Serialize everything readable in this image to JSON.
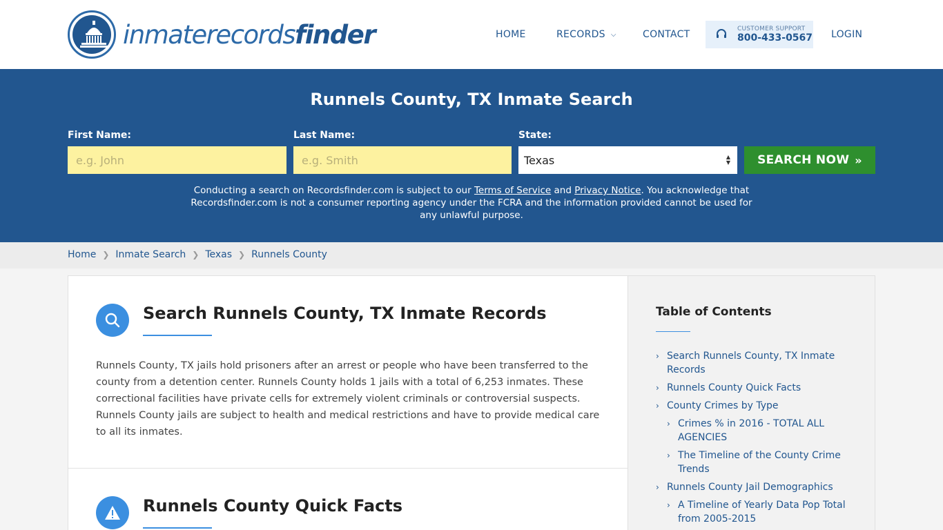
{
  "header": {
    "logo_text_light": "inmaterecords",
    "logo_text_bold": "finder",
    "nav": {
      "home": "HOME",
      "records": "RECORDS",
      "contact": "CONTACT",
      "login": "LOGIN"
    },
    "support": {
      "label": "CUSTOMER SUPPORT",
      "phone": "800-433-0567"
    }
  },
  "hero": {
    "title": "Runnels County, TX Inmate Search",
    "first_name": {
      "label": "First Name:",
      "placeholder": "e.g. John"
    },
    "last_name": {
      "label": "Last Name:",
      "placeholder": "e.g. Smith"
    },
    "state": {
      "label": "State:",
      "value": "Texas"
    },
    "search_button": "SEARCH NOW",
    "disclaimer": {
      "part1": "Conducting a search on Recordsfinder.com is subject to our ",
      "terms": "Terms of Service",
      "and": " and ",
      "privacy": "Privacy Notice",
      "part2": ". You acknowledge that Recordsfinder.com is not a consumer reporting agency under the FCRA and the information provided cannot be used for any unlawful purpose."
    }
  },
  "breadcrumb": [
    "Home",
    "Inmate Search",
    "Texas",
    "Runnels County"
  ],
  "main": {
    "section1": {
      "title": "Search Runnels County, TX Inmate Records",
      "body": "Runnels County, TX jails hold prisoners after an arrest or people who have been transferred to the county from a detention center. Runnels County holds 1 jails with a total of 6,253 inmates. These correctional facilities have private cells for extremely violent criminals or controversial suspects. Runnels County jails are subject to health and medical restrictions and have to provide medical care to all its inmates."
    },
    "section2": {
      "title": "Runnels County Quick Facts"
    }
  },
  "toc": {
    "title": "Table of Contents",
    "items": [
      "Search Runnels County, TX Inmate Records",
      "Runnels County Quick Facts",
      "County Crimes by Type",
      "Crimes % in 2016 - TOTAL ALL AGENCIES",
      "The Timeline of the County Crime Trends",
      "Runnels County Jail Demographics",
      "A Timeline of Yearly Data Pop Total from 2005-2015"
    ]
  },
  "colors": {
    "brand_blue": "#22568f",
    "accent_blue": "#3b8fe0",
    "search_green": "#2e8f2e",
    "input_yellow": "#fdf2a0"
  }
}
